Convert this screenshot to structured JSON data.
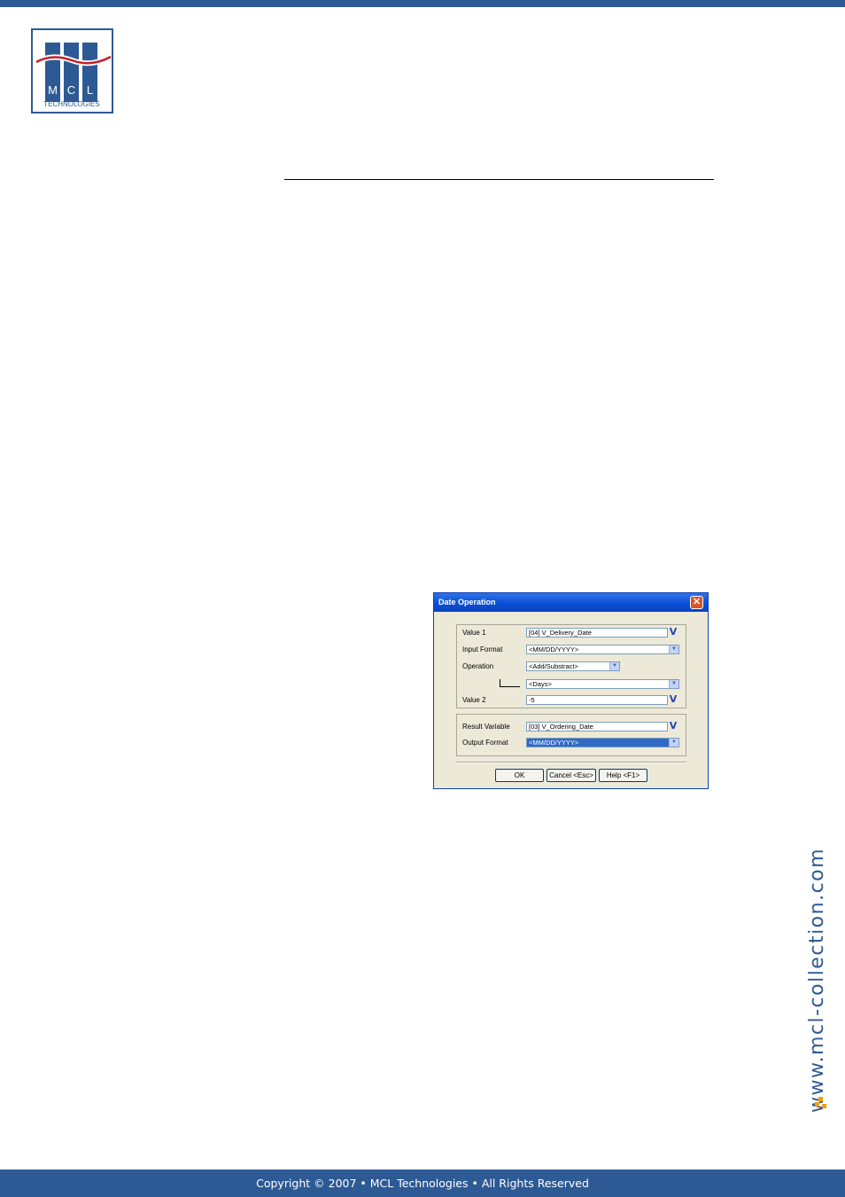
{
  "logo": {
    "letters": [
      "M",
      "C",
      "L"
    ],
    "subtext": "TECHNOLOGIES"
  },
  "dialog": {
    "title": "Date Operation",
    "value1": {
      "label": "Value 1",
      "value": "[04] V_Delivery_Date"
    },
    "input_format": {
      "label": "Input Format",
      "value": "<MM/DD/YYYY>"
    },
    "operation": {
      "label": "Operation",
      "value": "<Add/Substract>"
    },
    "unit": {
      "value": "<Days>"
    },
    "value2": {
      "label": "Value 2",
      "value": "-5"
    },
    "result_variable": {
      "label": "Result Variable",
      "value": "[03] V_Ordering_Date"
    },
    "output_format": {
      "label": "Output Format",
      "value": "<MM/DD/YYYY>"
    },
    "buttons": {
      "ok": "OK",
      "cancel": "Cancel <Esc>",
      "help": "Help <F1>"
    }
  },
  "side_url": "www.mcl-collection.com",
  "footer": {
    "copyright": "Copyright © 2007 • MCL Technologies • All Rights Reserved"
  },
  "colors": {
    "brand_blue": "#2d5a94",
    "logo_red": "#c8202b",
    "accent_orange": "#f39c12"
  },
  "icons": {
    "close": "close-icon",
    "variable": "variable-select-icon",
    "dropdown": "chevron-down-icon"
  }
}
